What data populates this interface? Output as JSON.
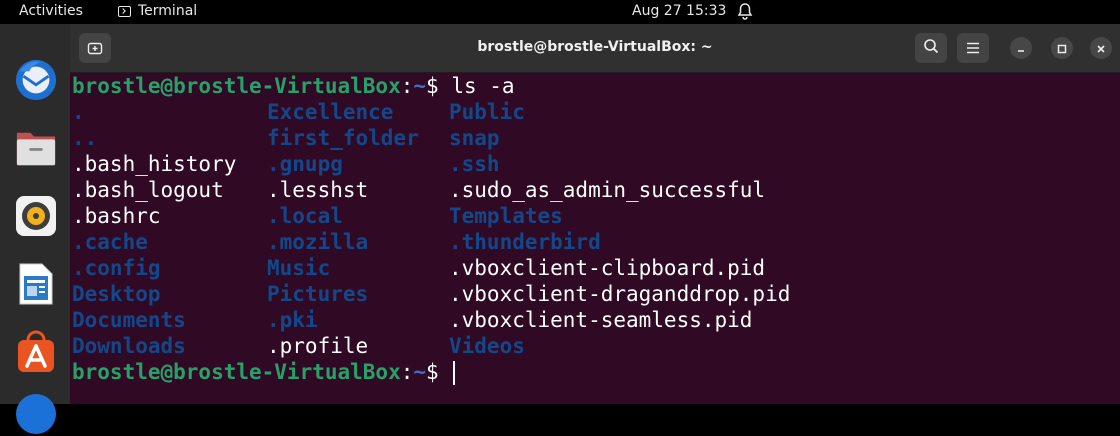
{
  "topbar": {
    "activities": "Activities",
    "app_name": "Terminal",
    "datetime": "Aug 27  15:33"
  },
  "window": {
    "title": "brostle@brostle-VirtualBox: ~"
  },
  "terminal": {
    "prompt_user": "brostle@brostle-VirtualBox",
    "prompt_sep": ":",
    "prompt_path": "~",
    "prompt_symbol": "$ ",
    "command": "ls -a",
    "rows": [
      [
        {
          "t": ".",
          "d": true
        },
        {
          "t": "Excellence",
          "d": true
        },
        {
          "t": "Public",
          "d": true
        }
      ],
      [
        {
          "t": "..",
          "d": true
        },
        {
          "t": "first_folder",
          "d": true
        },
        {
          "t": "snap",
          "d": true
        }
      ],
      [
        {
          "t": ".bash_history",
          "d": false
        },
        {
          "t": ".gnupg",
          "d": true
        },
        {
          "t": ".ssh",
          "d": true
        }
      ],
      [
        {
          "t": ".bash_logout",
          "d": false
        },
        {
          "t": ".lesshst",
          "d": false
        },
        {
          "t": ".sudo_as_admin_successful",
          "d": false
        }
      ],
      [
        {
          "t": ".bashrc",
          "d": false
        },
        {
          "t": ".local",
          "d": true
        },
        {
          "t": "Templates",
          "d": true
        }
      ],
      [
        {
          "t": ".cache",
          "d": true
        },
        {
          "t": ".mozilla",
          "d": true
        },
        {
          "t": ".thunderbird",
          "d": true
        }
      ],
      [
        {
          "t": ".config",
          "d": true
        },
        {
          "t": "Music",
          "d": true
        },
        {
          "t": ".vboxclient-clipboard.pid",
          "d": false
        }
      ],
      [
        {
          "t": "Desktop",
          "d": true
        },
        {
          "t": "Pictures",
          "d": true
        },
        {
          "t": ".vboxclient-draganddrop.pid",
          "d": false
        }
      ],
      [
        {
          "t": "Documents",
          "d": true
        },
        {
          "t": ".pki",
          "d": true
        },
        {
          "t": ".vboxclient-seamless.pid",
          "d": false
        }
      ],
      [
        {
          "t": "Downloads",
          "d": true
        },
        {
          "t": ".profile",
          "d": false
        },
        {
          "t": "Videos",
          "d": true
        }
      ]
    ]
  },
  "dock": {
    "items": [
      "thunderbird-icon",
      "files-icon",
      "rhythmbox-icon",
      "libreoffice-writer-icon",
      "app-center-icon",
      "help-icon"
    ]
  },
  "colors": {
    "terminal_bg": "#300a24",
    "directory": "#12488b",
    "prompt_user": "#26a269",
    "prompt_path": "#3f6ec6"
  }
}
